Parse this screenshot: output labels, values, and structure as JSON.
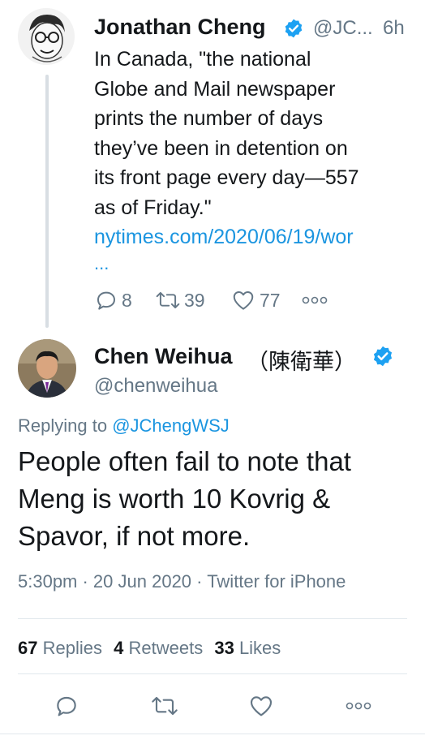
{
  "parent_tweet": {
    "author_name": "Jonathan Cheng",
    "author_handle": "@JC...",
    "age": "6h",
    "text_lines": [
      "In Canada, \"the national",
      "Globe and Mail newspaper",
      "prints the number of days",
      "they’ve been in detention on",
      "its front page every day—557",
      "as of Friday.\""
    ],
    "link": "nytimes.com/2020/06/19/wor",
    "link_ellipsis": "...",
    "reply_count": "8",
    "retweet_count": "39",
    "like_count": "77"
  },
  "main_tweet": {
    "author_name": "Chen Weihua",
    "author_name_cjk": "（陳衛華）",
    "author_handle": "@chenweihua",
    "replying_prefix": "Replying to",
    "replying_to": "@JChengWSJ",
    "text_lines": [
      "People often fail to note that",
      "Meng is worth 10 Kovrig &",
      "Spavor, if not more."
    ],
    "timestamp": "5:30pm · 20 Jun 2020 · Twitter for iPhone",
    "stats": {
      "replies_count": "67",
      "replies_label": "Replies",
      "retweets_count": "4",
      "retweets_label": "Retweets",
      "likes_count": "33",
      "likes_label": "Likes"
    }
  },
  "colors": {
    "link": "#1b95e0",
    "verified": "#1da1f2",
    "secondary_text": "#657786",
    "divider": "#e1e8ed"
  },
  "icons": {
    "verified": "verified-badge-icon",
    "reply": "reply-icon",
    "retweet": "retweet-icon",
    "like": "heart-icon",
    "more": "more-icon",
    "share": "share-icon"
  }
}
